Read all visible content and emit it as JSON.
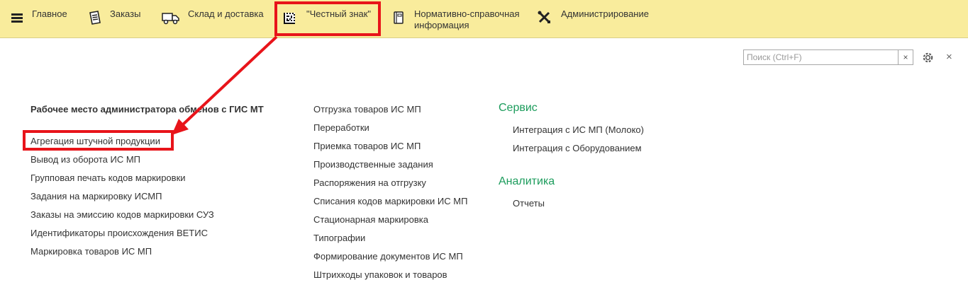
{
  "nav": {
    "items": [
      {
        "label": "Главное",
        "icon": "hamburger-menu-icon"
      },
      {
        "label": "Заказы",
        "icon": "receipt-icon"
      },
      {
        "label": "Склад и доставка",
        "icon": "truck-icon"
      },
      {
        "label": "\"Честный знак\"",
        "icon": "datamatrix-code-icon"
      },
      {
        "label": "Нормативно-справочная информация",
        "icon": "book-icon"
      },
      {
        "label": "Администрирование",
        "icon": "tools-icon"
      }
    ]
  },
  "toolbar": {
    "search_placeholder": "Поиск (Ctrl+F)",
    "clear_symbol": "×",
    "close_symbol": "×"
  },
  "column1": {
    "heading": "Рабочее место администратора обменов с ГИС МТ",
    "items": [
      "Агрегация штучной продукции",
      "Вывод из оборота ИС МП",
      "Групповая печать кодов маркировки",
      "Задания на маркировку ИСМП",
      "Заказы на эмиссию кодов маркировки СУЗ",
      "Идентификаторы происхождения ВЕТИС",
      "Маркировка товаров ИС МП"
    ]
  },
  "column2": {
    "items": [
      "Отгрузка товаров ИС МП",
      "Переработки",
      "Приемка товаров ИС МП",
      "Производственные задания",
      "Распоряжения на отгрузку",
      "Списания кодов маркировки ИС МП",
      "Стационарная маркировка",
      "Типографии",
      "Формирование документов ИС МП",
      "Штрихкоды упаковок и товаров"
    ]
  },
  "column3": {
    "service": {
      "title": "Сервис",
      "items": [
        "Интеграция с ИС МП (Молоко)",
        "Интеграция с Оборудованием"
      ]
    },
    "analytics": {
      "title": "Аналитика",
      "items": [
        "Отчеты"
      ]
    }
  },
  "colors": {
    "topbar": "#f9ec9c",
    "highlight": "#e8141a",
    "section_title": "#1c9c5c"
  }
}
